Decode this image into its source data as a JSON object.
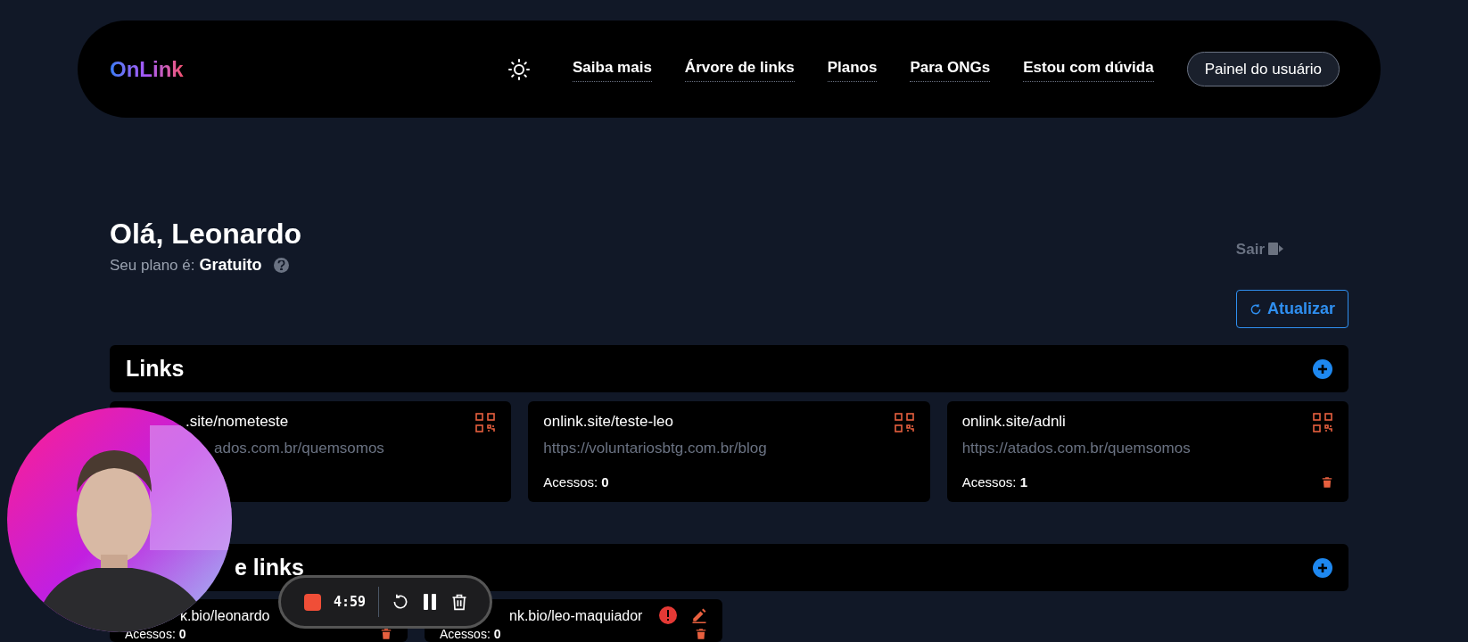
{
  "header": {
    "logo": "OnLink",
    "nav": [
      "Saiba mais",
      "Árvore de links",
      "Planos",
      "Para ONGs",
      "Estou com dúvida"
    ],
    "panel_button": "Painel do usuário"
  },
  "greeting": "Olá, Leonardo",
  "plan": {
    "label": "Seu plano é:",
    "value": "Gratuito"
  },
  "logout": "Sair",
  "refresh_button": "Atualizar",
  "sections": [
    {
      "title": "Links",
      "cards": [
        {
          "title": ".site/nometeste",
          "url": "ados.com.br/quemsomos",
          "qr": true,
          "warning": false,
          "edit": false,
          "delete": false
        },
        {
          "title": "onlink.site/teste-leo",
          "url": "https://voluntariosbtg.com.br/blog",
          "accesses_label": "Acessos:",
          "accesses": "0",
          "qr": true,
          "warning": false,
          "edit": false,
          "delete": false
        },
        {
          "title": "onlink.site/adnli",
          "url": "https://atados.com.br/quemsomos",
          "accesses_label": "Acessos:",
          "accesses": "1",
          "qr": true,
          "warning": false,
          "edit": false,
          "delete": true
        }
      ]
    },
    {
      "title": "e links",
      "cards": [
        {
          "title": "k.bio/leonardo",
          "accesses_label": "Acessos:",
          "accesses": "0",
          "qr": false,
          "warning": false,
          "edit": false,
          "delete": true
        },
        {
          "title": "nk.bio/leo-maquiador",
          "accesses_label": "Acessos:",
          "accesses": "0",
          "qr": false,
          "warning": true,
          "edit": true,
          "delete": true
        }
      ]
    }
  ],
  "recorder": {
    "time": "4:59"
  }
}
